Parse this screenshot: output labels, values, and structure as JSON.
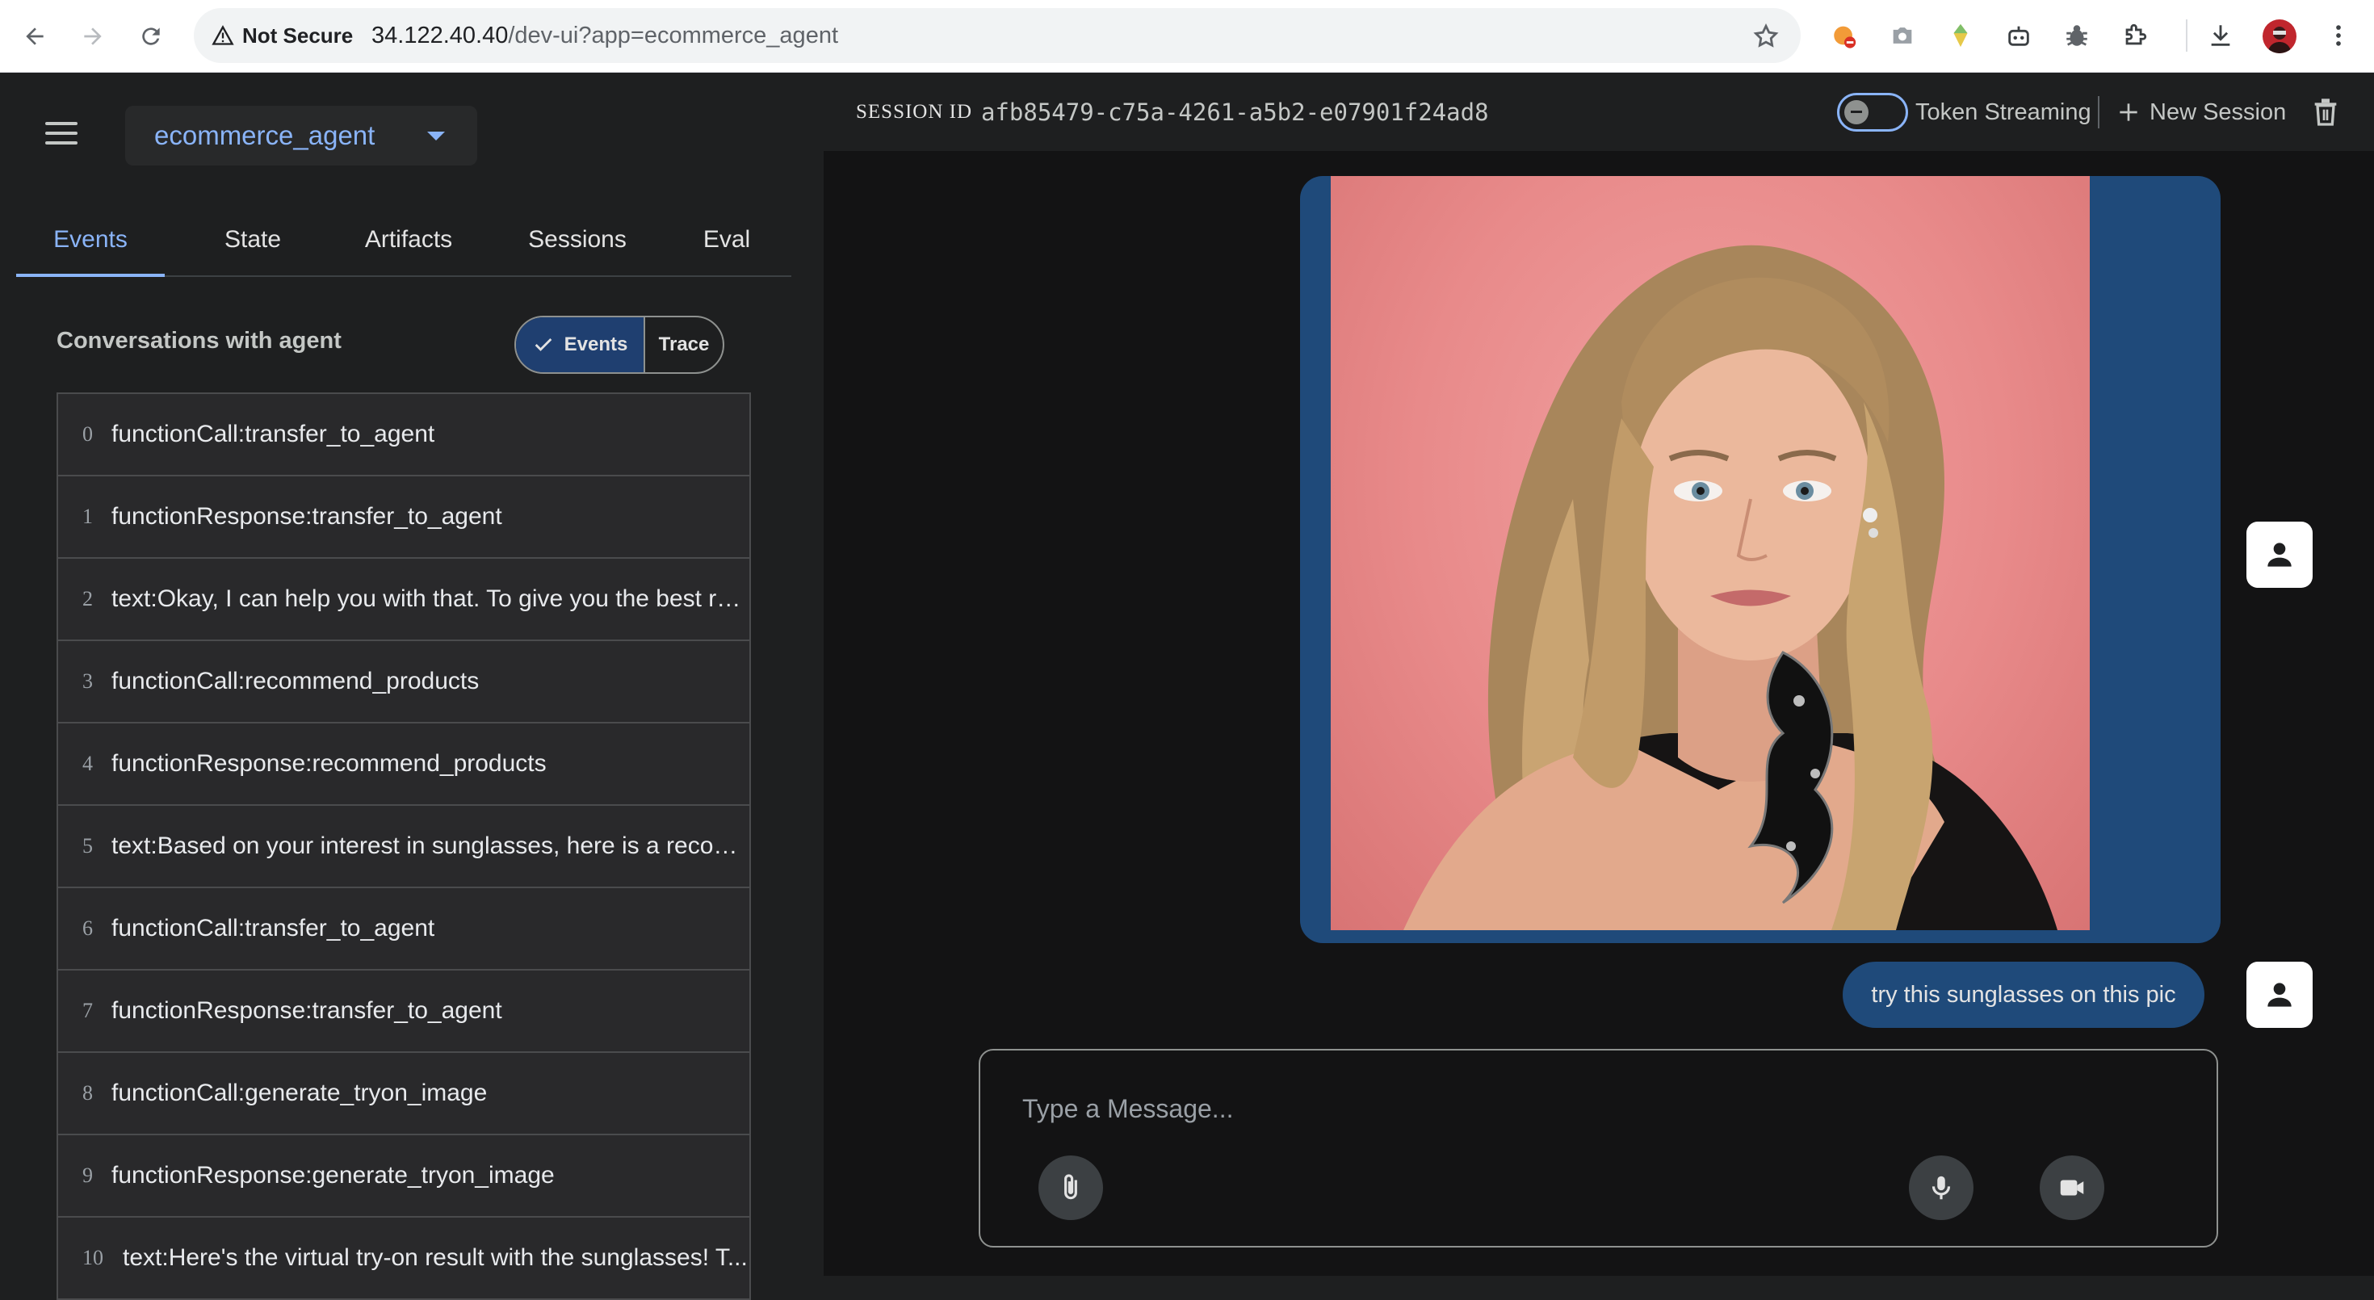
{
  "browser": {
    "security_label": "Not Secure",
    "url_host": "34.122.40.40",
    "url_path": "/dev-ui?app=ecommerce_agent"
  },
  "app": {
    "selected_app": "ecommerce_agent"
  },
  "tabs": [
    {
      "label": "Events",
      "active": true
    },
    {
      "label": "State"
    },
    {
      "label": "Artifacts"
    },
    {
      "label": "Sessions"
    },
    {
      "label": "Eval"
    }
  ],
  "conversations": {
    "label": "Conversations with agent",
    "toggle_events": "Events",
    "toggle_trace": "Trace"
  },
  "events": [
    {
      "index": "0",
      "text": "functionCall:transfer_to_agent"
    },
    {
      "index": "1",
      "text": "functionResponse:transfer_to_agent"
    },
    {
      "index": "2",
      "text": "text:Okay, I can help you with that. To give you the best re..."
    },
    {
      "index": "3",
      "text": "functionCall:recommend_products"
    },
    {
      "index": "4",
      "text": "functionResponse:recommend_products"
    },
    {
      "index": "5",
      "text": "text:Based on your interest in sunglasses, here is a recom..."
    },
    {
      "index": "6",
      "text": "functionCall:transfer_to_agent"
    },
    {
      "index": "7",
      "text": "functionResponse:transfer_to_agent"
    },
    {
      "index": "8",
      "text": "functionCall:generate_tryon_image"
    },
    {
      "index": "9",
      "text": "functionResponse:generate_tryon_image"
    },
    {
      "index": "10",
      "text": "text:Here's the virtual try-on result with the sunglasses! T..."
    }
  ],
  "session": {
    "label": "SESSION ID",
    "id": "afb85479-c75a-4261-a5b2-e07901f24ad8",
    "token_streaming_label": "Token Streaming",
    "token_streaming_on": false,
    "new_session_label": "New Session"
  },
  "chat": {
    "user_message": "try this sunglasses on this pic",
    "composer_placeholder": "Type a Message..."
  },
  "colors": {
    "accent": "#8ab4f8",
    "bubble": "#1f4a7a",
    "panel": "#1e1f20",
    "chat_bg": "#131314"
  }
}
